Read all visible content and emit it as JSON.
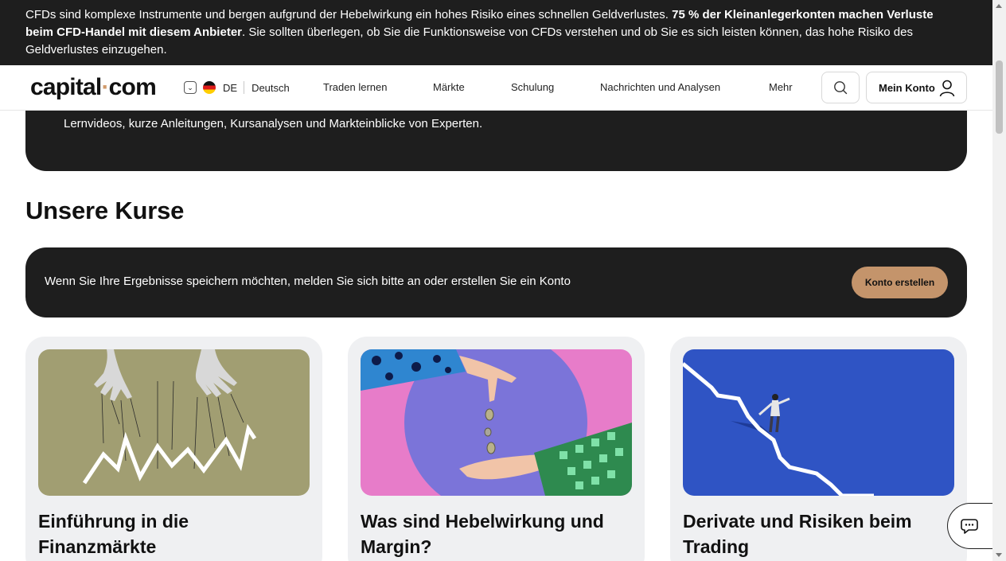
{
  "risk_banner": {
    "text_1": "CFDs sind komplexe Instrumente und bergen aufgrund der Hebelwirkung ein hohes Risiko eines schnellen Geldverlustes. ",
    "bold": "75 % der Kleinanlegerkonten machen Verluste beim CFD-Handel mit diesem Anbieter",
    "text_2": ". Sie sollten überlegen, ob Sie die Funktionsweise von CFDs verstehen und ob Sie es sich leisten können, das hohe Risiko des Geldverlustes einzugehen."
  },
  "header": {
    "logo_left": "capital",
    "logo_dot": "·",
    "logo_right": "com",
    "lang_code": "DE",
    "lang_name": "Deutsch",
    "nav": [
      "Traden lernen",
      "Märkte",
      "Schulung",
      "Nachrichten und Analysen",
      "Mehr"
    ],
    "account_label": "Mein Konto"
  },
  "hero": {
    "text": "Lernvideos, kurze Anleitungen, Kursanalysen und Markteinblicke von Experten."
  },
  "section_title": "Unsere Kurse",
  "login_banner": {
    "text": "Wenn Sie Ihre Ergebnisse speichern möchten, melden Sie sich bitte an oder erstellen Sie ein Konto",
    "button": "Konto erstellen"
  },
  "courses": [
    {
      "title_line1": "Einführung in die",
      "title_line2": "Finanzmärkte",
      "image": "puppet-hands-chart"
    },
    {
      "title_line1": "Was sind Hebelwirkung und",
      "title_line2": "Margin?",
      "image": "hands-dropping-coins"
    },
    {
      "title_line1": "Derivate und Risiken beim",
      "title_line2": "Trading",
      "image": "person-balancing-on-chart"
    }
  ],
  "colors": {
    "dark": "#1e1e1e",
    "accent": "#c4946b",
    "card_bg": "#eff0f2"
  }
}
